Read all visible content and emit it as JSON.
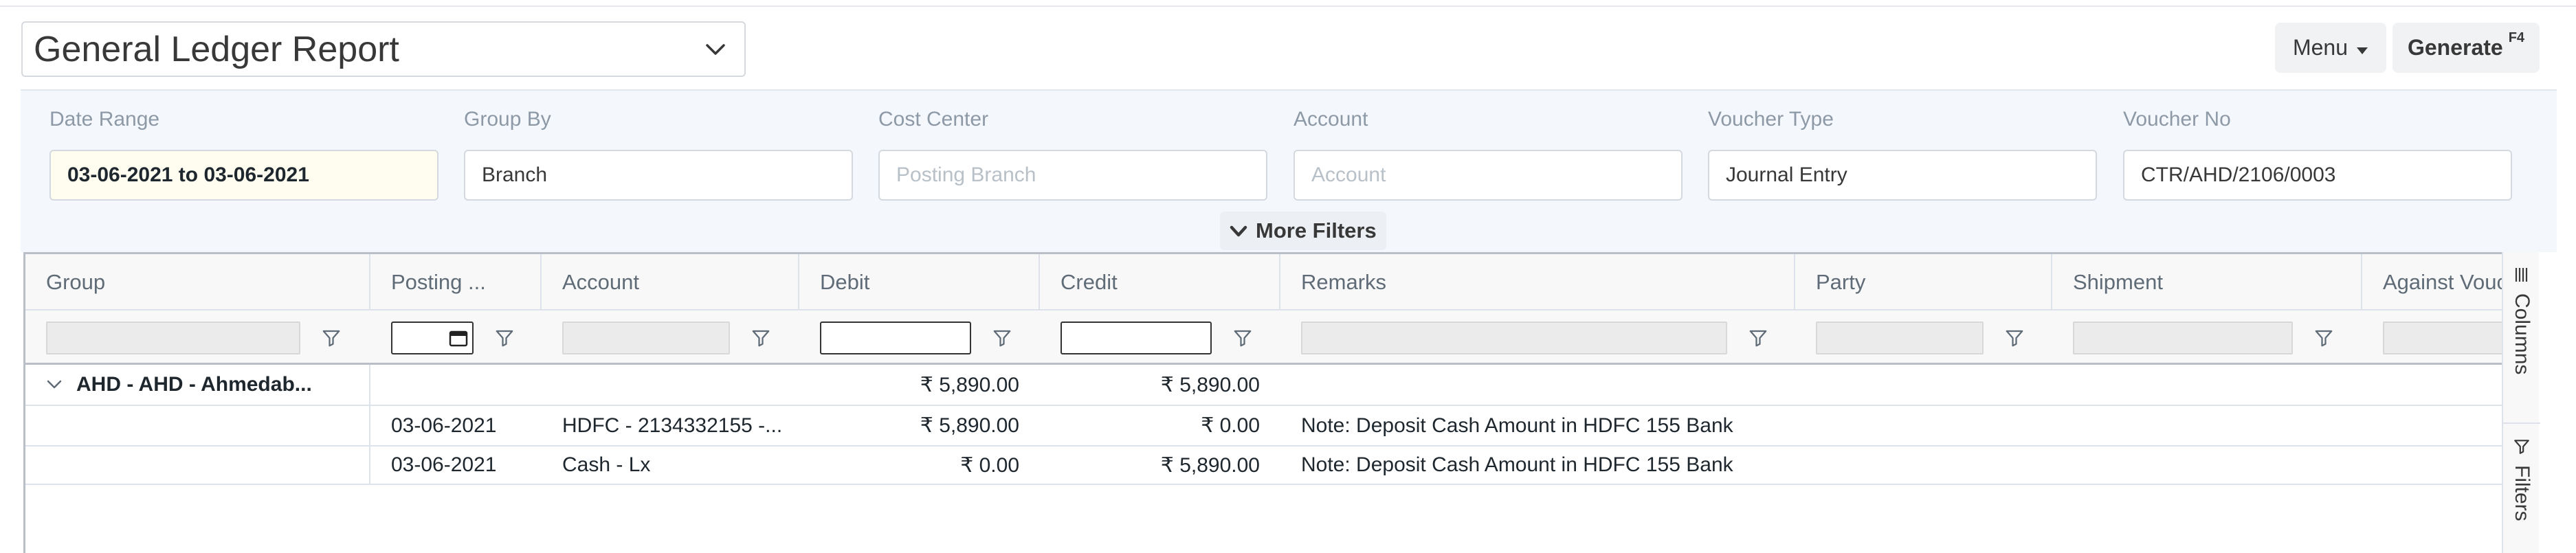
{
  "header": {
    "report_title": "General Ledger Report",
    "menu_label": "Menu",
    "generate_label": "Generate",
    "generate_shortcut": "F4"
  },
  "filters": {
    "date_range": {
      "label": "Date Range",
      "value": "03-06-2021 to 03-06-2021"
    },
    "group_by": {
      "label": "Group By",
      "value": "Branch"
    },
    "cost_center": {
      "label": "Cost Center",
      "placeholder": "Posting Branch"
    },
    "account": {
      "label": "Account",
      "placeholder": "Account"
    },
    "voucher_type": {
      "label": "Voucher Type",
      "value": "Journal Entry"
    },
    "voucher_no": {
      "label": "Voucher No",
      "value": "CTR/AHD/2106/0003"
    },
    "more_filters_label": "More Filters"
  },
  "grid": {
    "columns": [
      "Group",
      "Posting ...",
      "Account",
      "Debit",
      "Credit",
      "Remarks",
      "Party",
      "Shipment",
      "Against Vouc"
    ],
    "group_row": {
      "group": "AHD - AHD - Ahmedab...",
      "debit": "₹ 5,890.00",
      "credit": "₹ 5,890.00"
    },
    "rows": [
      {
        "posting_date": "03-06-2021",
        "account": "HDFC - 2134332155 -...",
        "debit": "₹ 5,890.00",
        "credit": "₹ 0.00",
        "remarks": "Note: Deposit Cash Amount in HDFC 155 Bank"
      },
      {
        "posting_date": "03-06-2021",
        "account": "Cash - Lx",
        "debit": "₹ 0.00",
        "credit": "₹ 5,890.00",
        "remarks": "Note: Deposit Cash Amount in HDFC 155 Bank"
      }
    ]
  },
  "side_tabs": {
    "columns_label": "Columns",
    "filters_label": "Filters"
  }
}
